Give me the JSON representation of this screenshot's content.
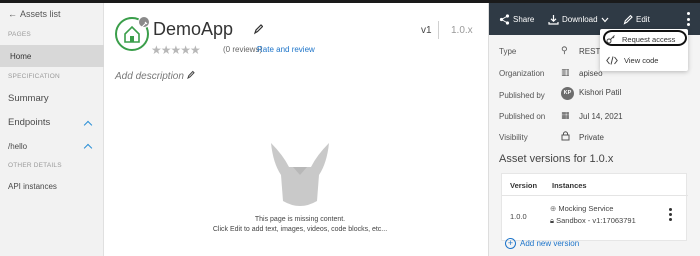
{
  "sidebar": {
    "back_label": "Assets list",
    "pages_header": "PAGES",
    "home_label": "Home",
    "spec_header": "SPECIFICATION",
    "summary_label": "Summary",
    "endpoints_label": "Endpoints",
    "hello_label": "/hello",
    "other_header": "OTHER DETAILS",
    "api_instances_label": "API instances"
  },
  "main": {
    "title": "DemoApp",
    "reviews": "(0 reviews)",
    "rate_link": "Rate and review",
    "version": "v1",
    "version_full": "1.0.x",
    "add_description": "Add description",
    "missing_line1": "This page is missing content.",
    "missing_line2": "Click Edit to add text, images, videos, code blocks, etc..."
  },
  "toolbar": {
    "share": "Share",
    "download": "Download",
    "edit": "Edit"
  },
  "menu": {
    "request_access": "Request access",
    "view_code": "View code"
  },
  "properties": {
    "type_label": "Type",
    "type_value": "REST A",
    "org_label": "Organization",
    "org_value": "apiseo",
    "published_by_label": "Published by",
    "published_by_initials": "KP",
    "published_by_value": "Kishori Patil",
    "published_on_label": "Published on",
    "published_on_value": "Jul 14, 2021",
    "visibility_label": "Visibility",
    "visibility_value": "Private"
  },
  "asset_versions": {
    "title": "Asset versions for 1.0.x",
    "col_version": "Version",
    "col_instances": "Instances",
    "row_version": "1.0.0",
    "instance_1": "Mocking Service",
    "instance_2": "Sandbox - v1:17063791",
    "add_new": "Add new version"
  },
  "colors": {
    "toolbar_bg": "#2f3a45",
    "link_blue": "#1d74c9",
    "logo_green": "#3a9e4a"
  }
}
